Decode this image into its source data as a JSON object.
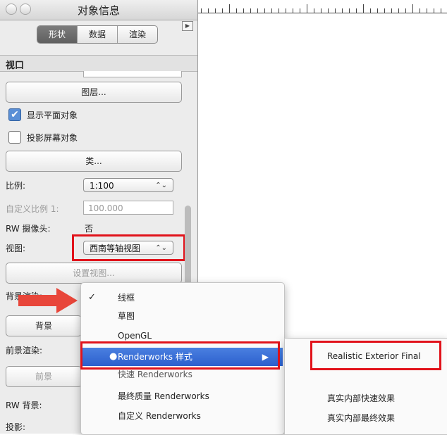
{
  "window": {
    "title": "对象信息"
  },
  "tabs": [
    {
      "label": "形状",
      "active": true
    },
    {
      "label": "数据",
      "active": false
    },
    {
      "label": "渲染",
      "active": false
    }
  ],
  "section": {
    "title": "视口"
  },
  "buttons": {
    "layers": "图层...",
    "classes": "类...",
    "set_view": "设置视图...",
    "background": "背景",
    "foreground": "前景"
  },
  "checkboxes": [
    {
      "label": "显示平面对象",
      "checked": true
    },
    {
      "label": "投影屏幕对象",
      "checked": false
    }
  ],
  "fields": {
    "scale_label": "比例:",
    "scale_value": "1:100",
    "custom_scale_label": "自定义比例 1:",
    "custom_scale_value": "100.000",
    "rw_camera_label": "RW 摄像头:",
    "rw_camera_value": "否",
    "view_label": "视图:",
    "view_value": "西南等轴视图",
    "background_render_label": "背景渲染:",
    "foreground_render_label": "前景渲染:",
    "rw_background_label": "RW 背景:",
    "projection_label": "投影:"
  },
  "menu": {
    "items": [
      {
        "label": "线框",
        "checked": true
      },
      {
        "label": "草图"
      },
      {
        "label": "OpenGL"
      },
      {
        "label": "Renderworks 样式",
        "active": true,
        "submenu": true
      },
      {
        "label": "快速 Renderworks"
      },
      {
        "label": "最终质量 Renderworks"
      },
      {
        "label": "自定义 Renderworks"
      }
    ]
  },
  "submenu": {
    "items": [
      {
        "label": "Realistic Exterior Final"
      },
      {
        "label": "真实内部快速效果"
      },
      {
        "label": "真实内部最终效果"
      }
    ]
  },
  "colors": {
    "highlight": "#e1131b",
    "menu_active": "#2c5fcd",
    "arrow": "#e8463a"
  },
  "icons": {
    "check": "✓",
    "checkbox_check": "✔",
    "bullet": "●",
    "submenu_arrow": "▶",
    "stepper": "⌃⌄",
    "panel_play": "▶"
  }
}
